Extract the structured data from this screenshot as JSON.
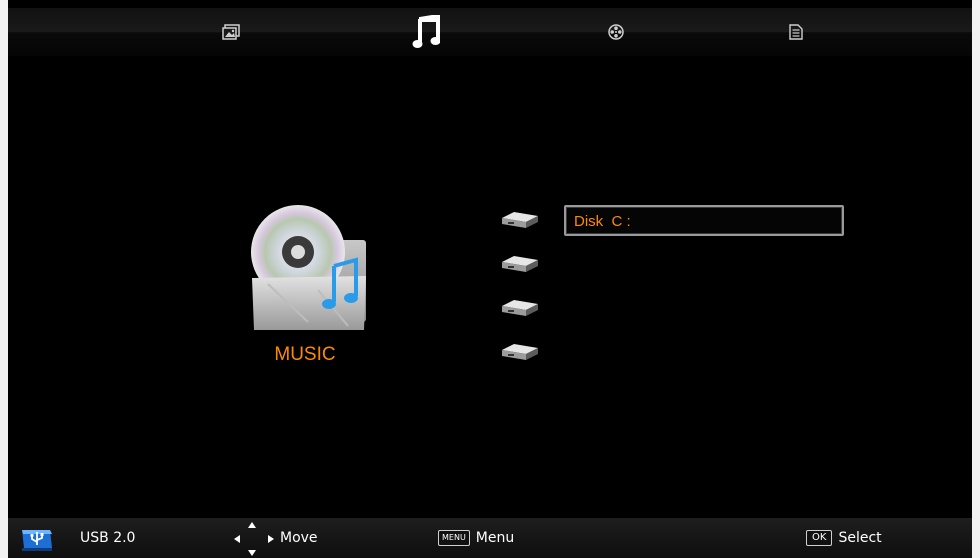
{
  "tabs": [
    {
      "name": "photo",
      "icon": "photo-icon",
      "active": false
    },
    {
      "name": "music",
      "icon": "music-note-icon",
      "active": true
    },
    {
      "name": "movie",
      "icon": "film-reel-icon",
      "active": false
    },
    {
      "name": "text",
      "icon": "document-icon",
      "active": false
    }
  ],
  "category": {
    "label": "MUSIC",
    "icon": "music-folder-icon"
  },
  "disks": [
    {
      "label": "Disk  C :",
      "selected": true,
      "icon": "hard-drive-icon"
    },
    {
      "label": "",
      "selected": false,
      "icon": "hard-drive-icon"
    },
    {
      "label": "",
      "selected": false,
      "icon": "hard-drive-icon"
    },
    {
      "label": "",
      "selected": false,
      "icon": "hard-drive-icon"
    }
  ],
  "footer": {
    "usb_label": "USB 2.0",
    "move_label": "Move",
    "menu_key": "MENU",
    "menu_label": "Menu",
    "ok_key": "OK",
    "select_label": "Select"
  },
  "colors": {
    "accent": "#ff8a00",
    "background": "#000000",
    "frame": "#f2f2f2"
  }
}
